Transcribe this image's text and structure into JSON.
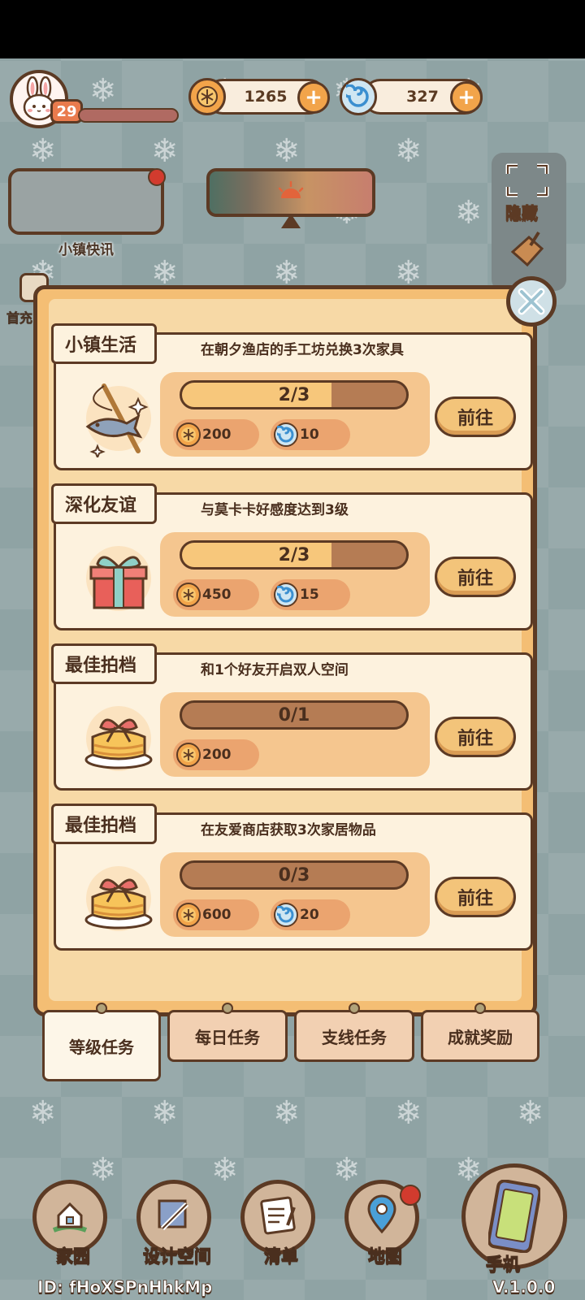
{
  "hud": {
    "level": "29",
    "coins": "1265",
    "gems": "327",
    "news_label": "小镇快讯",
    "hide_label": "隐藏",
    "side_label": "首充"
  },
  "tasks": [
    {
      "title": "小镇生活",
      "desc": "在朝夕渔店的手工坊兑换3次家具",
      "progress_text": "2/3",
      "progress": 0.667,
      "coin_reward": "200",
      "gem_reward": "10",
      "button": "前往",
      "icon": "fish-rod-icon"
    },
    {
      "title": "深化友谊",
      "desc": "与莫卡卡好感度达到3级",
      "progress_text": "2/3",
      "progress": 0.667,
      "coin_reward": "450",
      "gem_reward": "15",
      "button": "前往",
      "icon": "gift-box-icon"
    },
    {
      "title": "最佳拍档",
      "desc": "和1个好友开启双人空间",
      "progress_text": "0/1",
      "progress": 0,
      "coin_reward": "200",
      "gem_reward": "",
      "button": "前往",
      "icon": "cake-icon"
    },
    {
      "title": "最佳拍档",
      "desc": "在友爱商店获取3次家居物品",
      "progress_text": "0/3",
      "progress": 0,
      "coin_reward": "600",
      "gem_reward": "20",
      "button": "前往",
      "icon": "cake-icon"
    }
  ],
  "tabs": [
    {
      "label": "等级任务",
      "active": true
    },
    {
      "label": "每日任务",
      "active": false
    },
    {
      "label": "支线任务",
      "active": false
    },
    {
      "label": "成就奖励",
      "active": false
    }
  ],
  "nav": [
    {
      "label": "家园",
      "icon": "home-icon"
    },
    {
      "label": "设计空间",
      "icon": "design-ruler-icon"
    },
    {
      "label": "清单",
      "icon": "checklist-icon"
    },
    {
      "label": "地图",
      "icon": "map-pin-icon"
    }
  ],
  "phone": {
    "label": "手机",
    "version": "V.1.0.0"
  },
  "user_id": "ID: fHoXSPnHhkMp",
  "colors": {
    "panel": "#f4be74",
    "card": "#fdf2de",
    "outline": "#5c3a24",
    "coin": "#f2a44a",
    "gem": "#4a9fd8",
    "alert": "#d23b2e"
  }
}
